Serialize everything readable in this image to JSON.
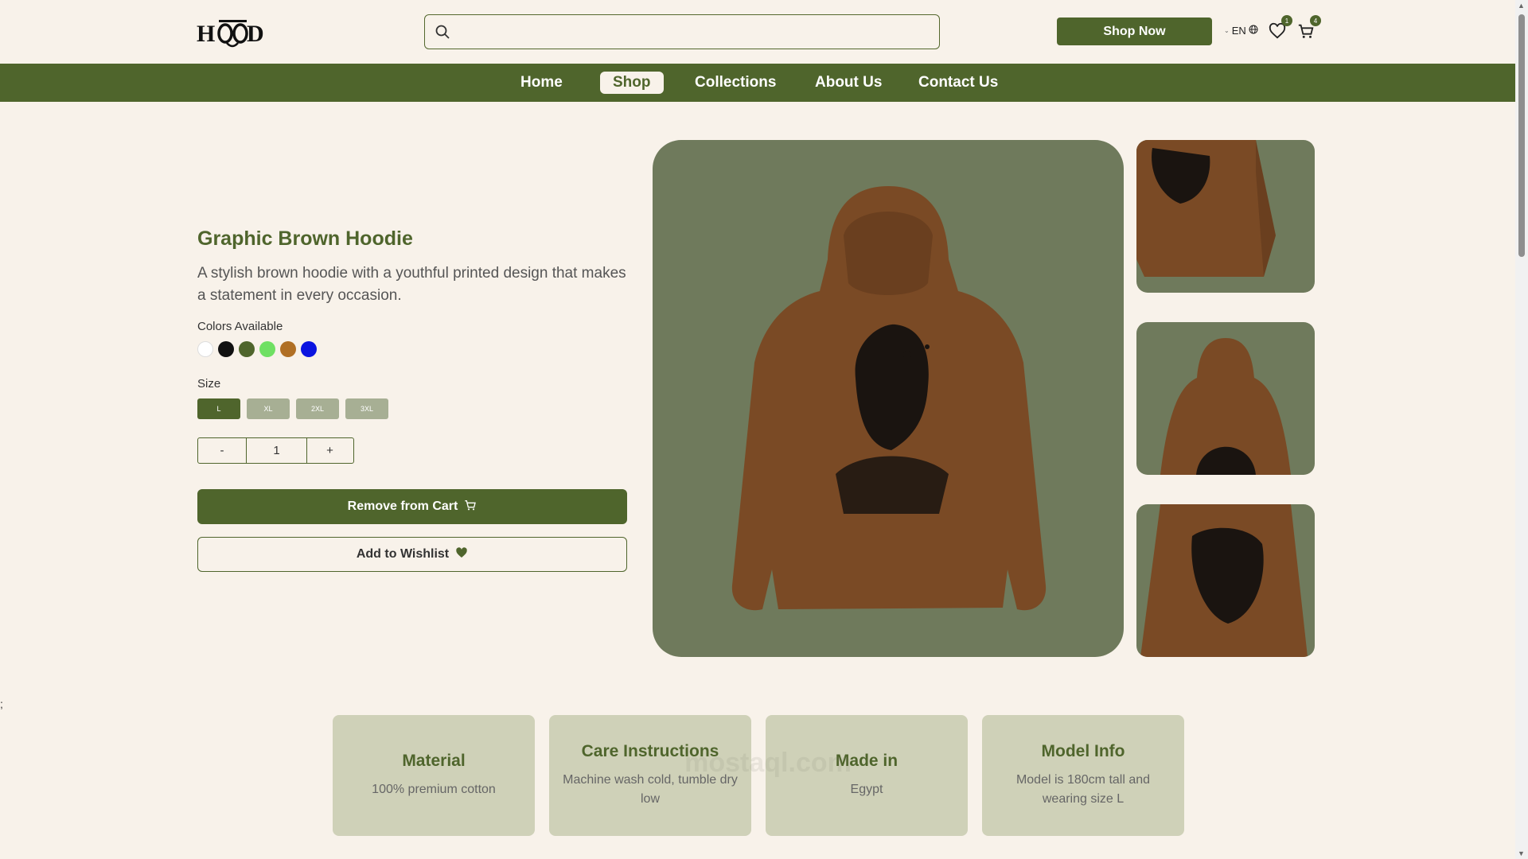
{
  "header": {
    "logo_text": "HOOD",
    "search_placeholder": "",
    "shop_now_label": "Shop Now",
    "language": "EN",
    "wishlist_count": "1",
    "cart_count": "4"
  },
  "nav": {
    "items": [
      "Home",
      "Shop",
      "Collections",
      "About Us",
      "Contact Us"
    ],
    "active": "Shop"
  },
  "product": {
    "title": "Graphic Brown Hoodie",
    "description": "A stylish brown hoodie with a youthful printed design that makes a statement in every occasion.",
    "colors_label": "Colors Available",
    "colors": [
      "#ffffff",
      "#111111",
      "#4f652c",
      "#6fe063",
      "#b06f24",
      "#0b14e0"
    ],
    "size_label": "Size",
    "sizes": [
      "L",
      "XL",
      "2XL",
      "3XL"
    ],
    "selected_size": "L",
    "quantity": {
      "minus": "-",
      "value": "1",
      "plus": "+"
    },
    "remove_label": "Remove from Cart",
    "wishlist_label": "Add to Wishlist"
  },
  "info_cards": [
    {
      "title": "Material",
      "value": "100% premium cotton"
    },
    {
      "title": "Care Instructions",
      "value": "Machine wash cold, tumble dry low"
    },
    {
      "title": "Made in",
      "value": "Egypt"
    },
    {
      "title": "Model Info",
      "value": "Model is 180cm tall and wearing size L"
    }
  ],
  "stray_text": ";",
  "watermark": "mostaql.com",
  "colors": {
    "brand_green": "#4f652c",
    "background": "#f8f2ea",
    "card_bg": "#cfd1b8",
    "image_bg": "#6f7a5c"
  }
}
